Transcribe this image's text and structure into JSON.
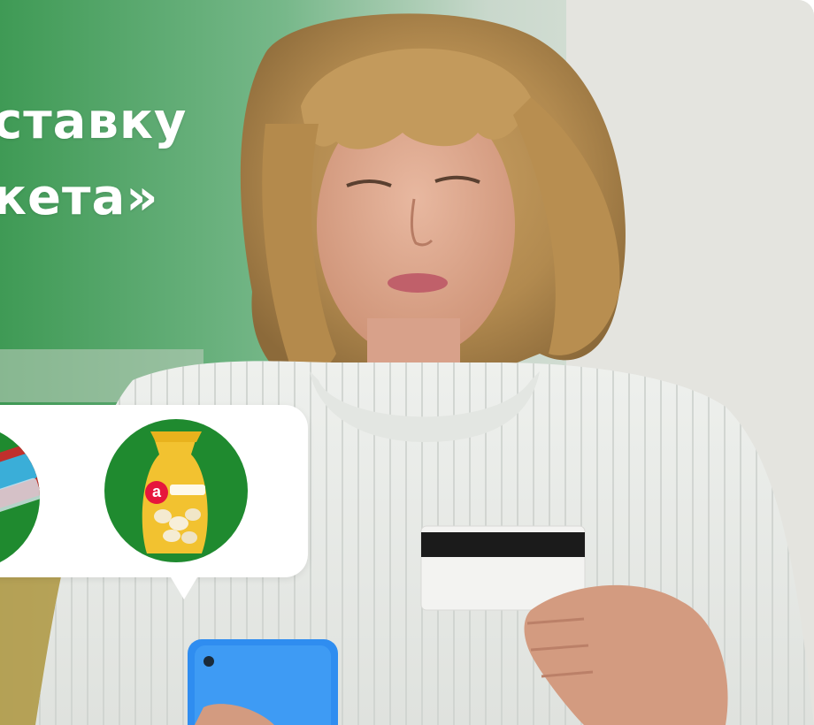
{
  "headline": {
    "line1": "ставку",
    "line2": "кета»"
  },
  "products": [
    {
      "name": "sausage-pack-product",
      "icon": "sausage-pack-icon"
    },
    {
      "name": "dumplings-bag-product",
      "icon": "dumplings-bag-icon",
      "badge": "а"
    }
  ],
  "colors": {
    "brand_green": "#1f8a2f",
    "headline_white": "#ffffff",
    "bag_yellow": "#f2c230",
    "phone_blue": "#2f8df0"
  }
}
